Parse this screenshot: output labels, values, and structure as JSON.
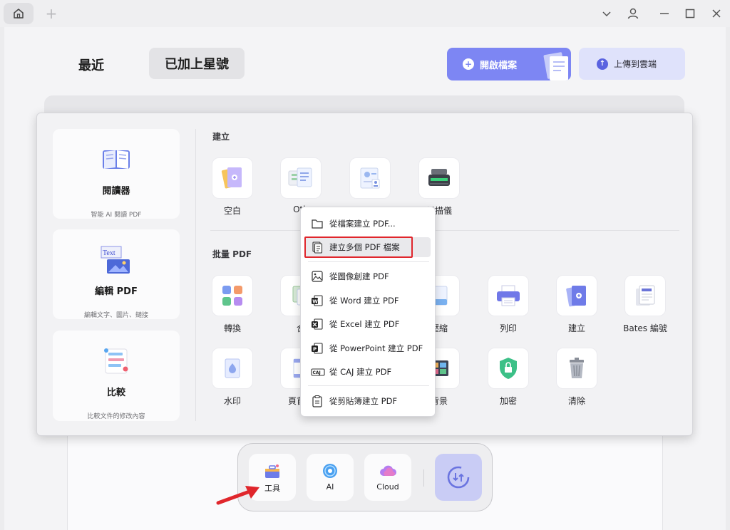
{
  "header": {
    "tabs": [
      "最近",
      "已加上星號"
    ],
    "open_label": "開啟檔案",
    "upload_label": "上傳到雲端"
  },
  "side_cards": [
    {
      "title": "閱讀器",
      "subtitle": "智能 AI 閱讀 PDF"
    },
    {
      "title": "編輯 PDF",
      "subtitle": "編輯文字、圖片、鏈接"
    },
    {
      "title": "比較",
      "subtitle": "比較文件的修改內容"
    }
  ],
  "sections": {
    "create": "建立",
    "batch": "批量 PDF"
  },
  "create_tools": [
    "空白",
    "Oth",
    "",
    "掃描儀"
  ],
  "batch_row1": [
    "轉換",
    "合",
    "壓縮",
    "列印",
    "建立",
    "Bates 編號"
  ],
  "batch_row2": [
    "水印",
    "頁首和",
    "背景",
    "加密",
    "清除"
  ],
  "menu": {
    "items": [
      "從檔案建立 PDF...",
      "建立多個 PDF 檔案",
      "從圖像創建 PDF",
      "從 Word 建立 PDF",
      "從 Excel 建立 PDF",
      "從 PowerPoint 建立 PDF",
      "從 CAJ 建立 PDF",
      "從剪貼簿建立 PDF"
    ],
    "caj_badge": "CAJ"
  },
  "dock": {
    "tools_label": "工具",
    "ai_label": "AI",
    "cloud_label": "Cloud"
  },
  "colors": {
    "accent": "#7d86f3",
    "highlight": "#e0262c"
  },
  "icons": {
    "text_sample": "Text"
  }
}
